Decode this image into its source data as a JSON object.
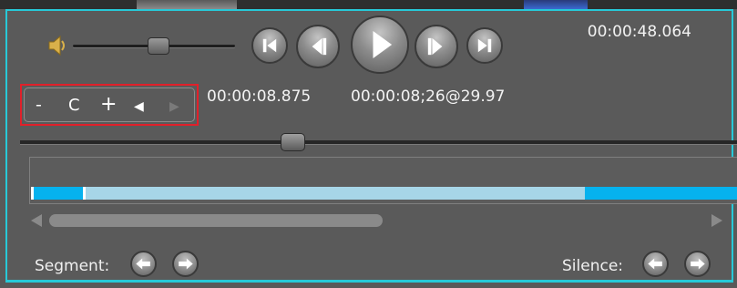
{
  "colors": {
    "frame_border": "#27c9d8",
    "highlight_box": "#e1202a",
    "clip_bright": "#06b2ee",
    "clip_light": "#a7d6e8"
  },
  "player": {
    "total_time": "00:00:48.064",
    "current_time": "00:00:08.875",
    "timecode": "00:00:08;26@29.97",
    "volume_level": 0.57,
    "seek_position": 0.37
  },
  "transport": {
    "buttons": [
      "skip-to-start",
      "step-back",
      "play",
      "step-forward",
      "skip-to-end"
    ]
  },
  "zoom_controls": {
    "minus": "-",
    "center": "C",
    "plus": "+",
    "prev": "◀",
    "next": "▶"
  },
  "timeline": {
    "clip_start": 0.0,
    "clip_in": 0.075,
    "clip_out": 0.79,
    "scroll_position": 0.0,
    "scroll_size": 0.47
  },
  "footer": {
    "segment_label": "Segment:",
    "silence_label": "Silence:"
  }
}
